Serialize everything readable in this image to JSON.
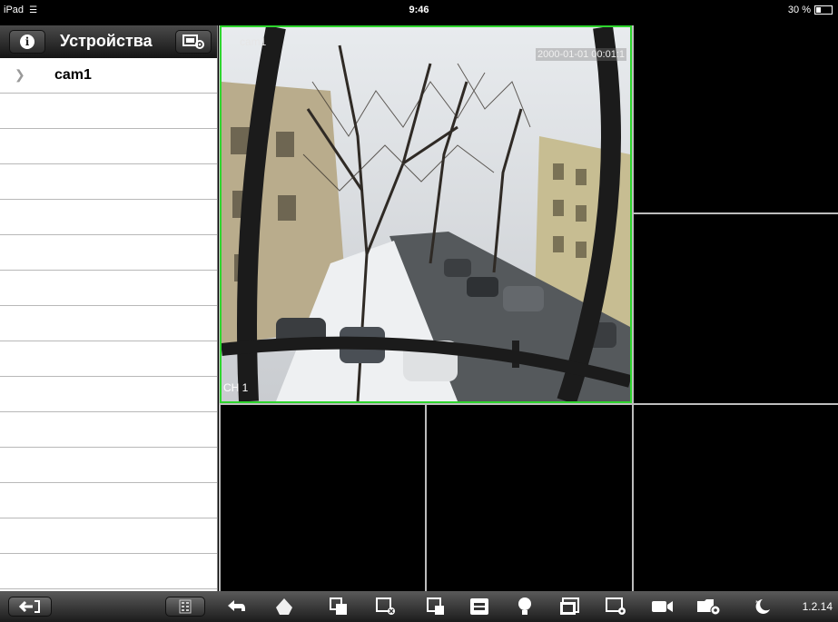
{
  "status_bar": {
    "device": "iPad",
    "time": "9:46",
    "battery": "30 %"
  },
  "sidebar": {
    "title": "Устройства",
    "devices": [
      {
        "label": "cam1"
      }
    ]
  },
  "video": {
    "active_channel": {
      "name": "cam1",
      "timestamp": "2000-01-01 00:01:1",
      "channel": "CH 1"
    }
  },
  "toolbar": {
    "icons": [
      "exit-icon",
      "list-view-icon",
      "back-icon",
      "ptz-icon",
      "layout-icon",
      "close-channel-icon",
      "single-view-icon",
      "multi-view-icon",
      "light-icon",
      "fullscreen-icon",
      "snapshot-icon",
      "record-icon",
      "playback-icon",
      "night-mode-icon"
    ],
    "version": "1.2.14"
  },
  "colors": {
    "active_border": "#2ed52e",
    "toolbar": "#2e2e2e"
  }
}
